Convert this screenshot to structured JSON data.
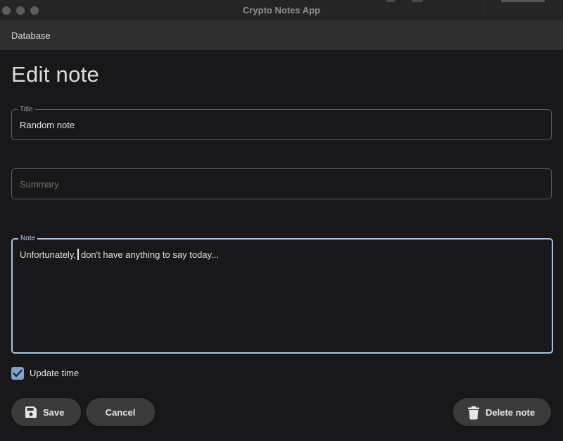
{
  "window": {
    "title": "Crypto Notes App"
  },
  "appbar": {
    "label": "Database"
  },
  "page": {
    "title": "Edit note"
  },
  "fields": {
    "title": {
      "label": "Title",
      "value": "Random note"
    },
    "summary": {
      "placeholder": "Summary",
      "value": ""
    },
    "note": {
      "label": "Note",
      "value_before_caret": "Unfortunately,",
      "value_after_caret": "don't have anything to say today..."
    }
  },
  "update_time": {
    "label": "Update time",
    "checked": true
  },
  "buttons": {
    "save": "Save",
    "cancel": "Cancel",
    "delete": "Delete note"
  },
  "icons": {
    "save": "floppy-disk-icon",
    "delete": "trash-can-icon",
    "checkbox": "check-icon"
  },
  "colors": {
    "background": "#18181b",
    "accent": "#7ea3c9",
    "focus_border": "#a9c3df",
    "button_bg": "#3a3a3b"
  }
}
